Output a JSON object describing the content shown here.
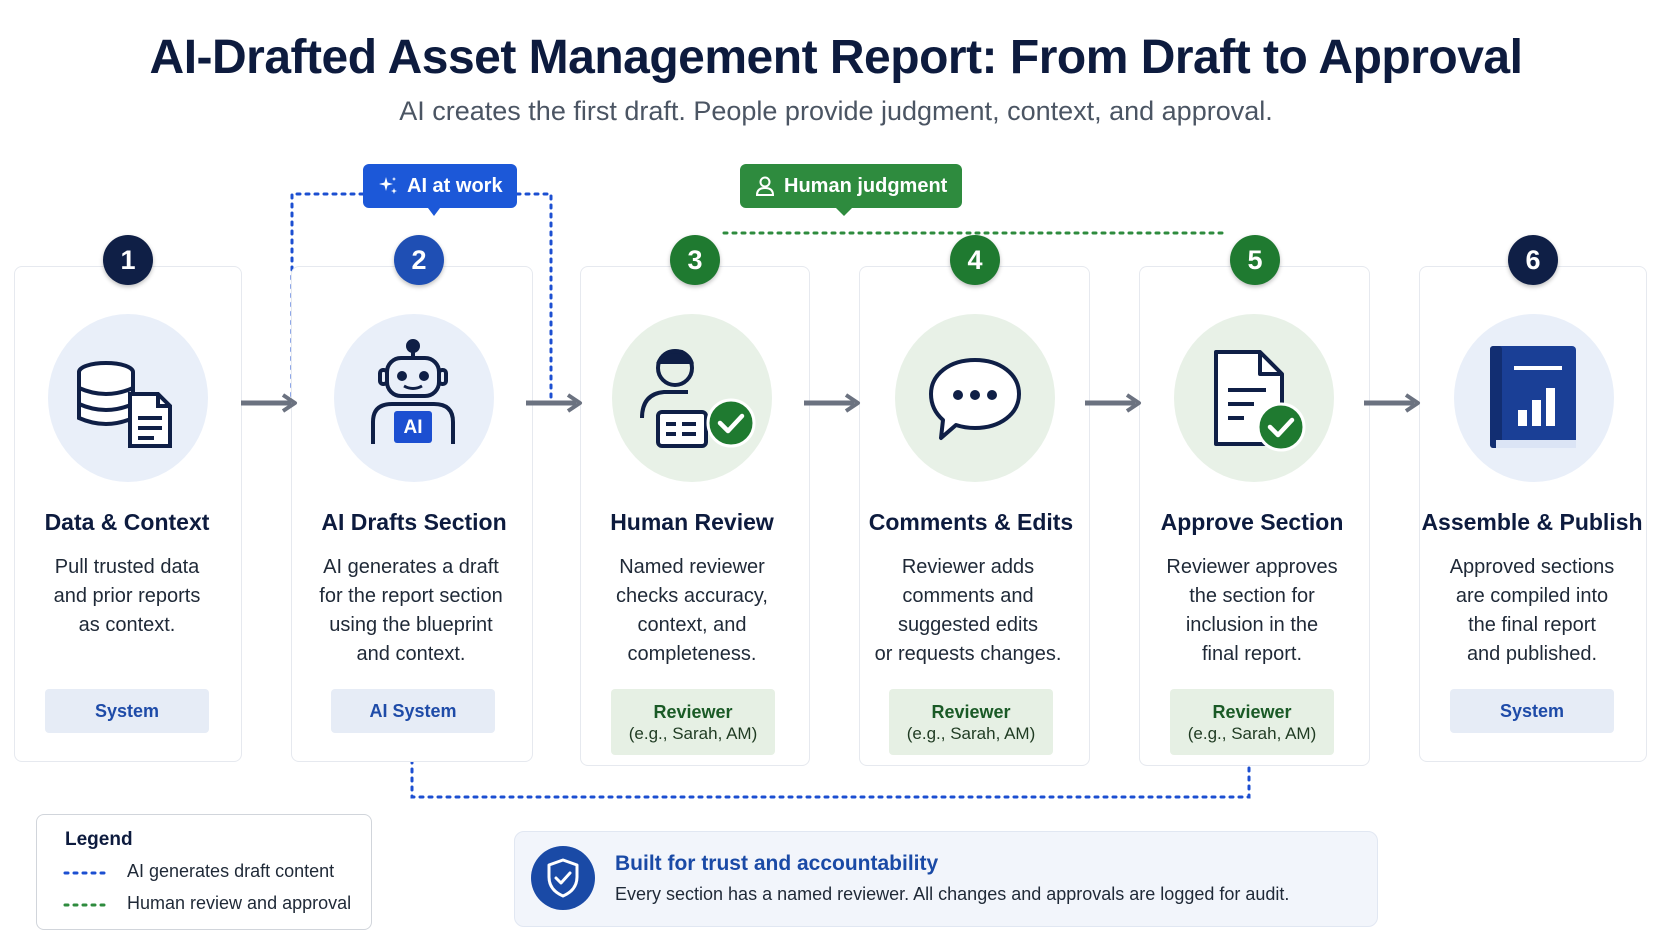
{
  "header": {
    "title": "AI-Drafted Asset Management Report: From Draft to Approval",
    "subtitle": "AI creates the first draft. People provide judgment, context, and approval."
  },
  "tags": {
    "ai": "AI at work",
    "human": "Human judgment"
  },
  "steps": [
    {
      "number": "1",
      "title": "Data & Context",
      "description": "Pull trusted data\nand prior reports\nas context.",
      "role": "System",
      "role_detail": ""
    },
    {
      "number": "2",
      "title": "AI Drafts Section",
      "description": "AI generates a draft\nfor the report section\nusing the blueprint\nand context.",
      "role": "AI System",
      "role_detail": "",
      "icon_label": "AI"
    },
    {
      "number": "3",
      "title": "Human Review",
      "description": "Named reviewer\nchecks accuracy,\ncontext, and\ncompleteness.",
      "role": "Reviewer",
      "role_detail": "(e.g., Sarah, AM)"
    },
    {
      "number": "4",
      "title": "Comments & Edits",
      "description": "Reviewer adds\ncomments and\nsuggested edits\nor requests changes.",
      "role": "Reviewer",
      "role_detail": "(e.g., Sarah, AM)"
    },
    {
      "number": "5",
      "title": "Approve Section",
      "description": "Reviewer approves\nthe section for\ninclusion in the\nfinal report.",
      "role": "Reviewer",
      "role_detail": "(e.g., Sarah, AM)"
    },
    {
      "number": "6",
      "title": "Assemble & Publish",
      "description": "Approved sections\nare compiled into\nthe final report\nand published.",
      "role": "System",
      "role_detail": ""
    }
  ],
  "legend": {
    "title": "Legend",
    "items": [
      {
        "label": "AI generates draft content",
        "color": "#1c4fd1"
      },
      {
        "label": "Human review and approval",
        "color": "#2e8b3e"
      }
    ]
  },
  "trust": {
    "title": "Built for trust and accountability",
    "description": "Every section has a named reviewer. All changes and approvals are logged for audit."
  },
  "colors": {
    "navy": "#0f1f46",
    "ai_blue": "#1c58d8",
    "human_green": "#2e8b3e",
    "arrow_gray": "#6b7280"
  }
}
